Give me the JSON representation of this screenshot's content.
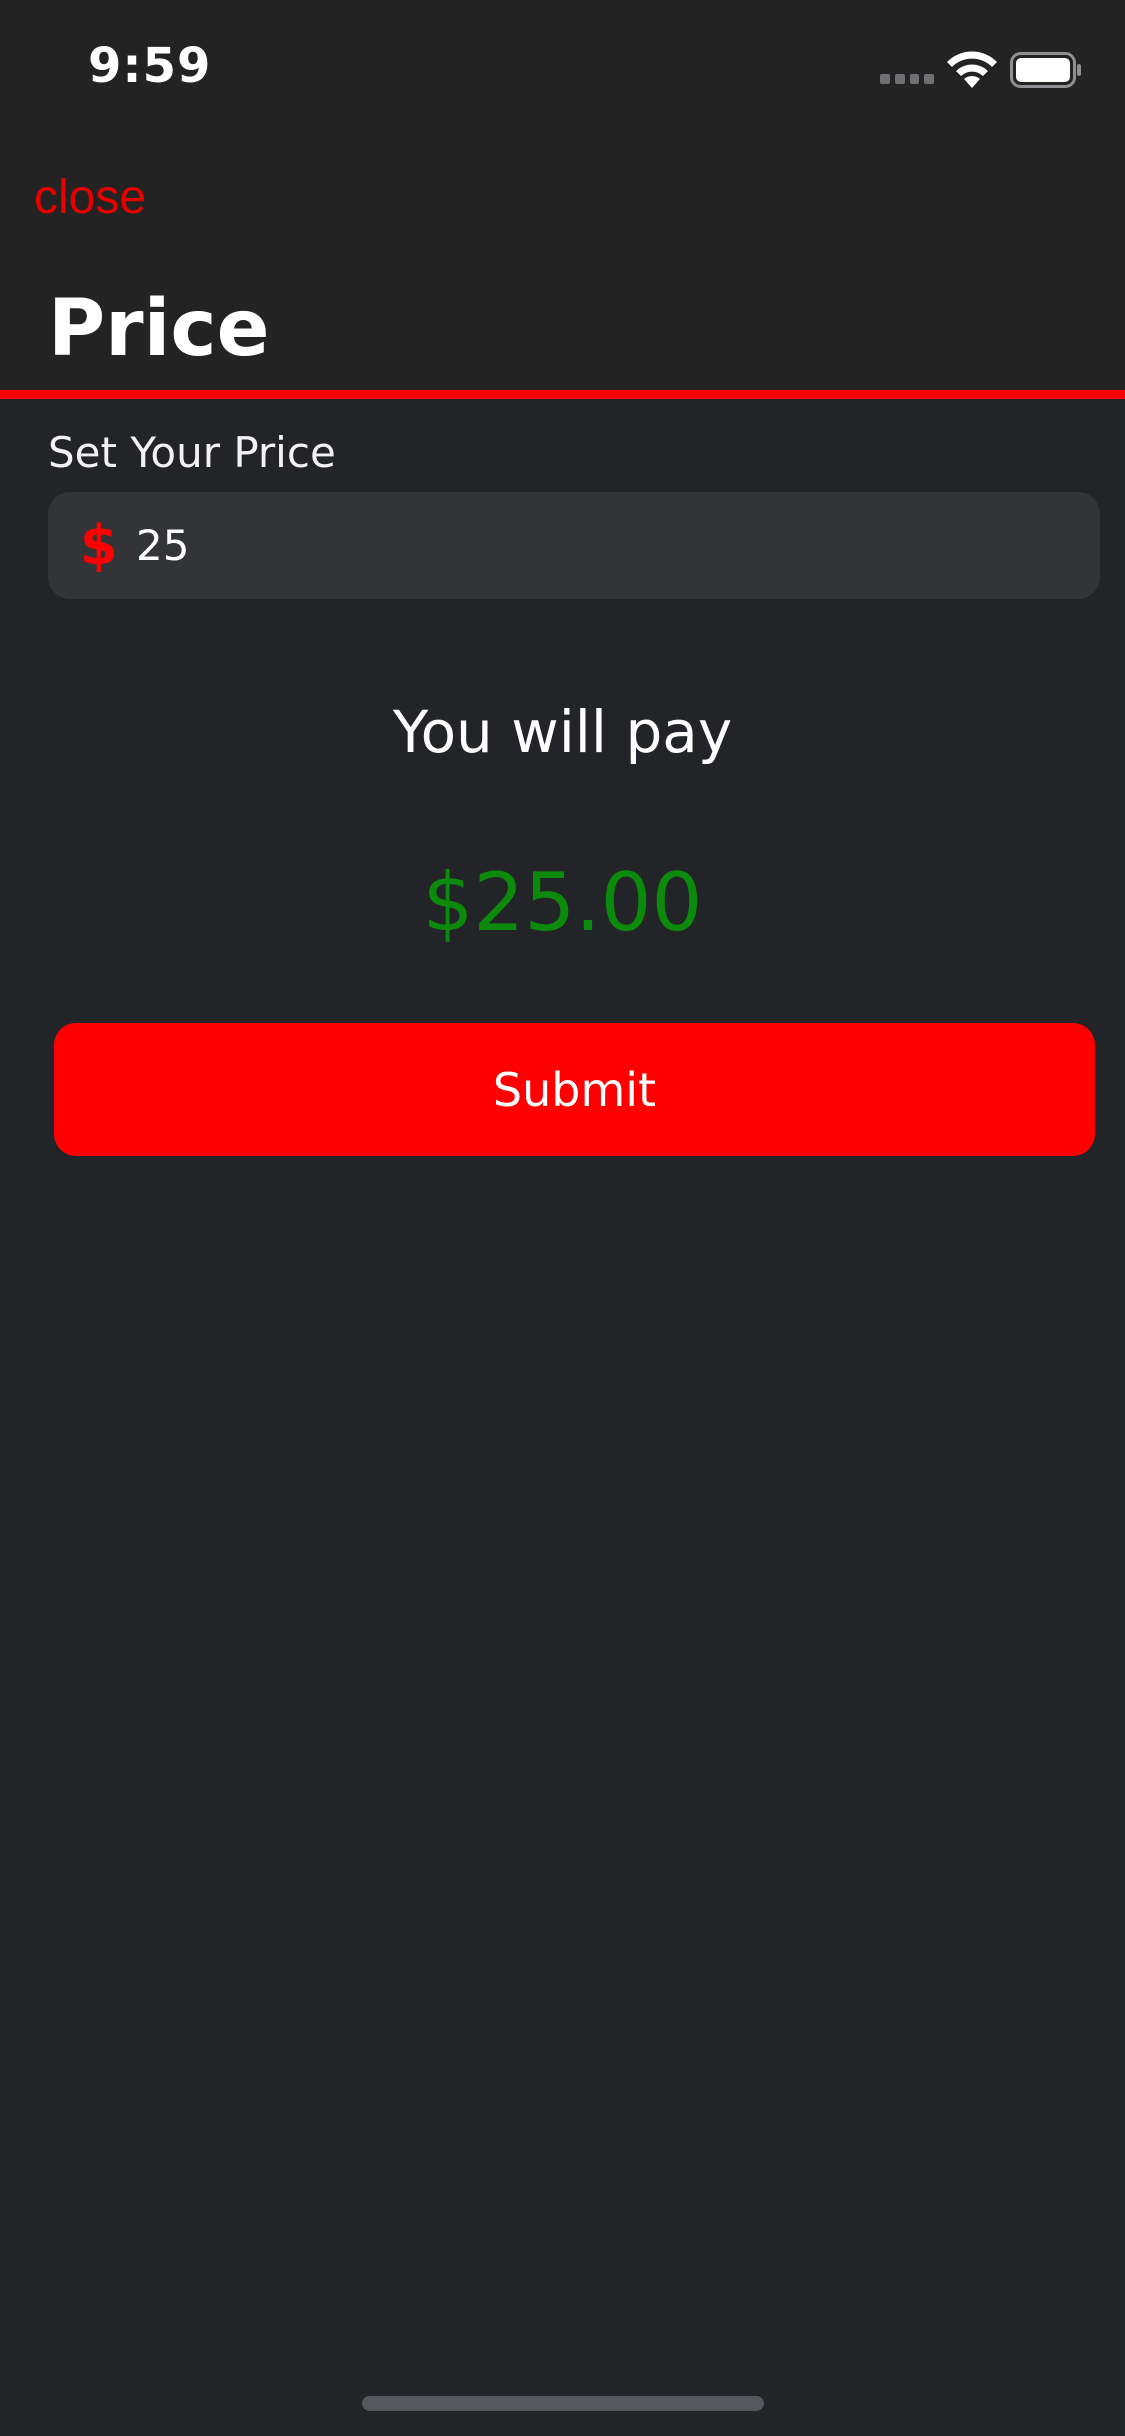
{
  "status_bar": {
    "time": "9:59"
  },
  "header": {
    "close_label": "close",
    "title": "Price"
  },
  "form": {
    "field_label": "Set Your Price",
    "currency_symbol": "$",
    "price_value": "25"
  },
  "summary": {
    "pay_label": "You will pay",
    "pay_amount": "$25.00"
  },
  "actions": {
    "submit_label": "Submit"
  },
  "colors": {
    "accent": "#ff0000",
    "amount": "#0b8a0b",
    "background": "#232428",
    "field_background": "#333438"
  },
  "icons": {
    "signal": "cellular-signal-icon",
    "wifi": "wifi-icon",
    "battery": "battery-icon",
    "currency": "dollar-icon"
  }
}
